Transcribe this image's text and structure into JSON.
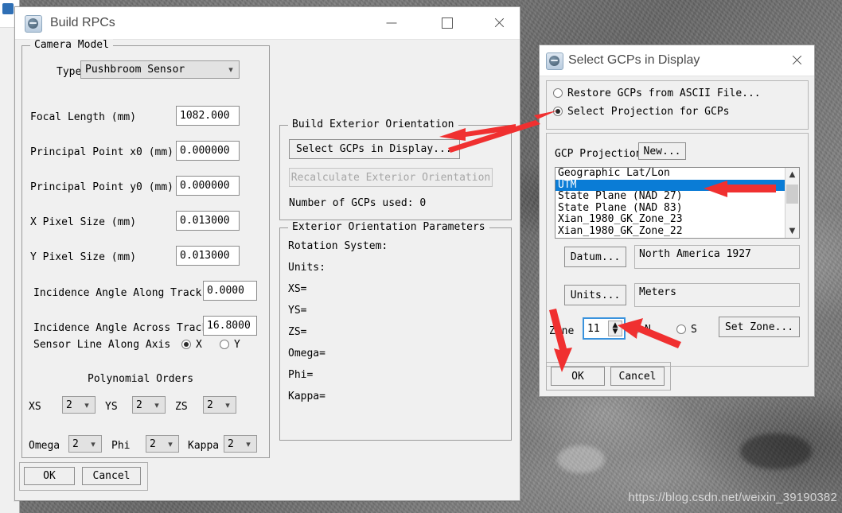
{
  "watermark": "https://blog.csdn.net/weixin_39190382",
  "build_rpcs": {
    "title": "Build RPCs",
    "window_buttons": {
      "minimize": "minimize-icon",
      "maximize": "maximize-icon",
      "close": "close-icon"
    },
    "camera_model": {
      "group_label": "Camera Model",
      "type_label": "Type",
      "type_value": "Pushbroom Sensor",
      "fields": [
        {
          "label": "Focal Length (mm)",
          "value": "1082.000"
        },
        {
          "label": "Principal Point x0 (mm)",
          "value": "0.000000"
        },
        {
          "label": "Principal Point y0 (mm)",
          "value": "0.000000"
        },
        {
          "label": "X Pixel Size (mm)",
          "value": "0.013000"
        },
        {
          "label": "Y Pixel Size (mm)",
          "value": "0.013000"
        },
        {
          "label": "Incidence Angle Along Track",
          "value": "0.0000"
        },
        {
          "label": "Incidence Angle Across Track",
          "value": "16.8000"
        }
      ],
      "sensor_axis_label": "Sensor Line Along Axis",
      "sensor_axis_x": "X",
      "sensor_axis_y": "Y",
      "sensor_axis_selected": "X",
      "poly_orders_label": "Polynomial Orders",
      "poly": [
        {
          "label": "XS",
          "value": "2"
        },
        {
          "label": "YS",
          "value": "2"
        },
        {
          "label": "ZS",
          "value": "2"
        },
        {
          "label": "Omega",
          "value": "2"
        },
        {
          "label": "Phi",
          "value": "2"
        },
        {
          "label": "Kappa",
          "value": "2"
        }
      ]
    },
    "build_ext": {
      "group_label": "Build Exterior Orientation",
      "select_gcps_button": "Select GCPs in Display...",
      "recalculate_button": "Recalculate Exterior Orientation",
      "gcp_count_text": "Number of GCPs used: 0"
    },
    "ext_params": {
      "group_label": "Exterior Orientation Parameters",
      "rows": [
        "Rotation System:",
        "Units:",
        "XS=",
        "YS=",
        "ZS=",
        "Omega=",
        "Phi=",
        "Kappa="
      ]
    },
    "ok_label": "OK",
    "cancel_label": "Cancel"
  },
  "select_gcps": {
    "title": "Select GCPs in Display",
    "close_icon": "close-icon",
    "options": [
      {
        "label": "Restore GCPs from ASCII File...",
        "selected": false
      },
      {
        "label": "Select Projection for GCPs",
        "selected": true
      }
    ],
    "projection_label": "GCP Projection",
    "new_button": "New...",
    "projection_list": [
      {
        "label": "Geographic Lat/Lon",
        "selected": false
      },
      {
        "label": "UTM",
        "selected": true
      },
      {
        "label": "State Plane (NAD 27)",
        "selected": false
      },
      {
        "label": "State Plane (NAD 83)",
        "selected": false
      },
      {
        "label": "Xian_1980_GK_Zone_23",
        "selected": false
      },
      {
        "label": "Xian_1980_GK_Zone_22",
        "selected": false
      }
    ],
    "datum_button": "Datum...",
    "datum_value": "North America 1927",
    "units_button": "Units...",
    "units_value": "Meters",
    "zone_label": "Zone",
    "zone_value": "11",
    "hemisphere_n": "N",
    "hemisphere_s": "S",
    "hemisphere_selected": "N",
    "set_zone_button": "Set Zone...",
    "ok_label": "OK",
    "cancel_label": "Cancel"
  },
  "annotations": {
    "accent_color": "#f03030",
    "arrows": [
      "arrow-to-select-gcps-button",
      "arrow-to-select-projection-radio",
      "arrow-to-utm-list-item",
      "arrow-to-zone-spinner",
      "arrow-to-ok-button"
    ]
  }
}
